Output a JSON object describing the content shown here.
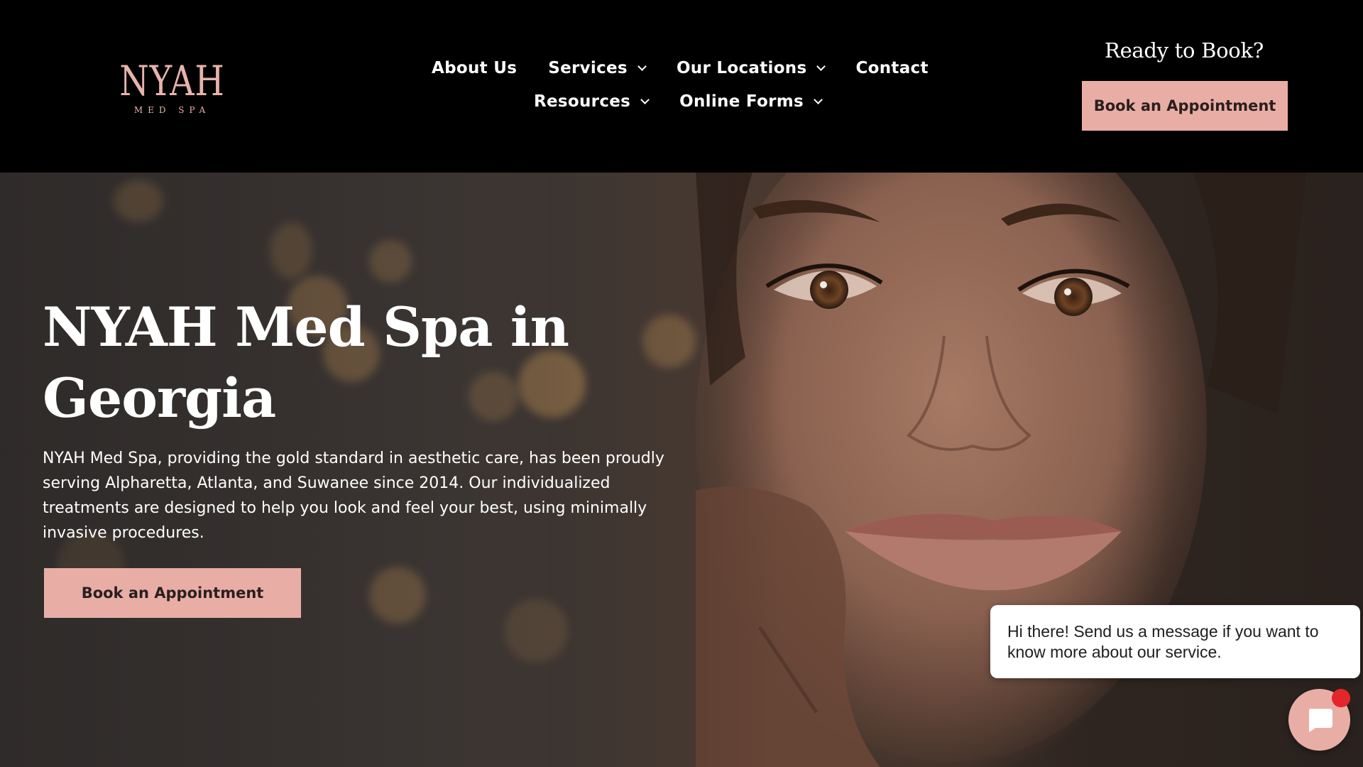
{
  "logo": {
    "main": "NYAH",
    "sub": "MED SPA"
  },
  "nav": {
    "row1": [
      {
        "label": "About Us",
        "dropdown": false
      },
      {
        "label": "Services",
        "dropdown": true
      },
      {
        "label": "Our Locations",
        "dropdown": true
      },
      {
        "label": "Contact",
        "dropdown": false
      }
    ],
    "row2": [
      {
        "label": "Resources",
        "dropdown": true
      },
      {
        "label": "Online Forms",
        "dropdown": true
      }
    ]
  },
  "header_cta": {
    "heading": "Ready to Book?",
    "button_label": "Book an Appointment"
  },
  "hero": {
    "title": "NYAH Med Spa in Georgia",
    "description": "NYAH Med Spa, providing the gold standard in aesthetic care, has been proudly serving Alpharetta, Atlanta, and Suwanee since 2014. Our individualized treatments are designed to help you look and feel your best, using minimally invasive procedures.",
    "button_label": "Book an Appointment"
  },
  "chat": {
    "message": "Hi there! Send us a message if you want to know more about our service.",
    "launcher_icon": "chat-icon",
    "unread_badge": true
  },
  "colors": {
    "accent": "#e8aea6",
    "logo": "#e7b3ac",
    "header_bg": "#000000",
    "badge": "#e3262b"
  }
}
